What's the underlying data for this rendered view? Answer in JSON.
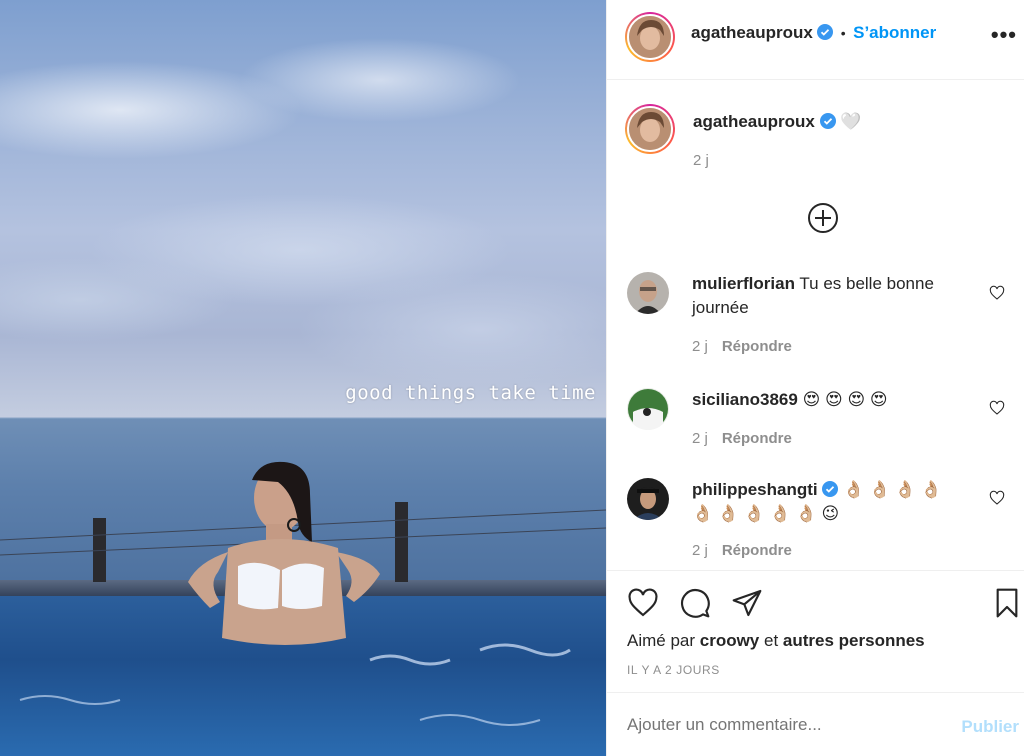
{
  "photo": {
    "overlay_text": "good things take time"
  },
  "header": {
    "username": "agatheauproux",
    "separator": "•",
    "follow_label": "S’abonner",
    "more_icon": "more-options-icon"
  },
  "caption": {
    "username": "agatheauproux",
    "emoji": "🤍",
    "time": "2 j"
  },
  "comments": [
    {
      "user": "mulierflorian",
      "text": "Tu es belle bonne journée",
      "time": "2 j",
      "reply": "Répondre"
    },
    {
      "user": "siciliano3869",
      "text": "😍 😍 😍 😍",
      "time": "2 j",
      "reply": "Répondre"
    },
    {
      "user": "philippeshangti",
      "text": "👌🏼 👌🏼 👌🏼 👌🏼 👌🏼 👌🏼 👌🏼 👌🏼 👌🏼 😉",
      "time": "2 j",
      "reply": "Répondre"
    }
  ],
  "actions": {
    "liked_prefix": "Aimé par ",
    "liked_user": "croowy",
    "liked_middle": " et ",
    "liked_others": "autres personnes",
    "timestamp": "IL Y A 2 JOURS"
  },
  "add_comment": {
    "placeholder": "Ajouter un commentaire...",
    "publish_label": "Publier"
  },
  "colors": {
    "link_blue": "#0095f6",
    "verified_blue": "#3897f0",
    "muted": "#8e8e8e",
    "publish_disabled": "#b2dffc"
  }
}
